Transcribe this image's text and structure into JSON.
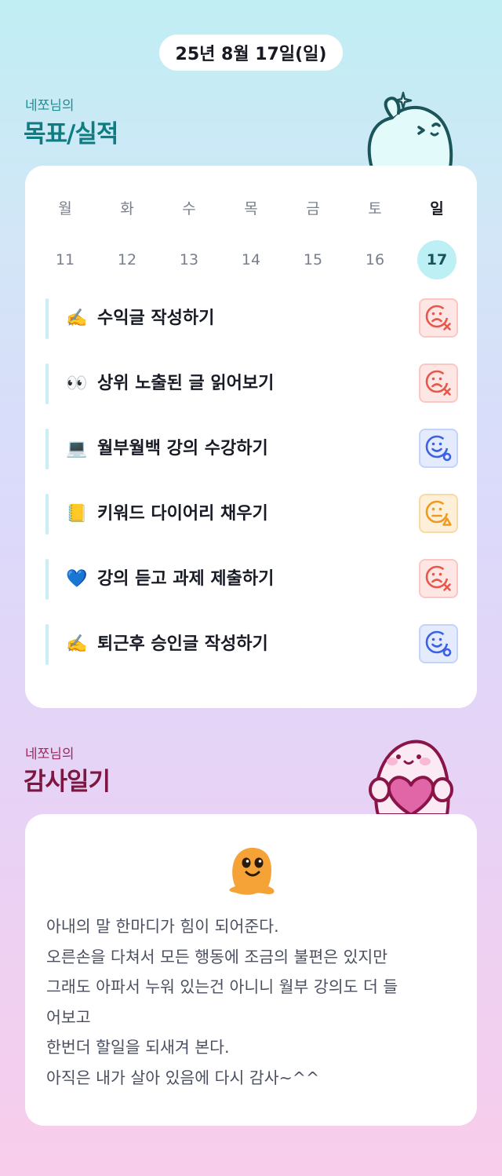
{
  "date": "25년 8월 17일(일)",
  "goals_section": {
    "subtitle": "네쪼님의",
    "title": "목표/실적"
  },
  "week": {
    "days": [
      {
        "weekday": "월",
        "date": "11",
        "today": false
      },
      {
        "weekday": "화",
        "date": "12",
        "today": false
      },
      {
        "weekday": "수",
        "date": "13",
        "today": false
      },
      {
        "weekday": "목",
        "date": "14",
        "today": false
      },
      {
        "weekday": "금",
        "date": "15",
        "today": false
      },
      {
        "weekday": "토",
        "date": "16",
        "today": false
      },
      {
        "weekday": "일",
        "date": "17",
        "today": true
      }
    ]
  },
  "goals": [
    {
      "emoji": "✍️",
      "text": "수익글 작성하기",
      "status": "fail",
      "status_icon": "sad-face-x-icon"
    },
    {
      "emoji": "👀",
      "text": "상위 노출된 글 읽어보기",
      "status": "fail",
      "status_icon": "sad-face-x-icon"
    },
    {
      "emoji": "💻",
      "text": "월부월백 강의 수강하기",
      "status": "success",
      "status_icon": "smile-face-circle-icon"
    },
    {
      "emoji": "📒",
      "text": "키워드 다이어리 채우기",
      "status": "partial",
      "status_icon": "neutral-face-triangle-icon"
    },
    {
      "emoji": "💙",
      "text": "강의 듣고 과제 제출하기",
      "status": "fail",
      "status_icon": "sad-face-x-icon"
    },
    {
      "emoji": "✍️",
      "text": "퇴근후 승인글 작성하기",
      "status": "success",
      "status_icon": "smile-face-circle-icon"
    }
  ],
  "gratitude_section": {
    "subtitle": "네쪼님의",
    "title": "감사일기"
  },
  "gratitude": {
    "icon": "melting-blob-icon",
    "lines": [
      "아내의 말 한마디가 힘이 되어준다.",
      "오른손을 다쳐서 모든 행동에 조금의 불편은 있지만",
      "그래도 아파서 누워 있는건 아니니 월부 강의도 더 들",
      "어보고",
      "한번더 할일을 되새겨 본다.",
      "아직은 내가 살아 있음에 다시 감사~^^"
    ]
  },
  "colors": {
    "fail": "#e8574a",
    "success": "#3c61e6",
    "partial": "#ee9a1e",
    "today_circle": "#bdf0f4",
    "goal_title": "#0e7c80",
    "gratitude_title": "#7d1640"
  }
}
